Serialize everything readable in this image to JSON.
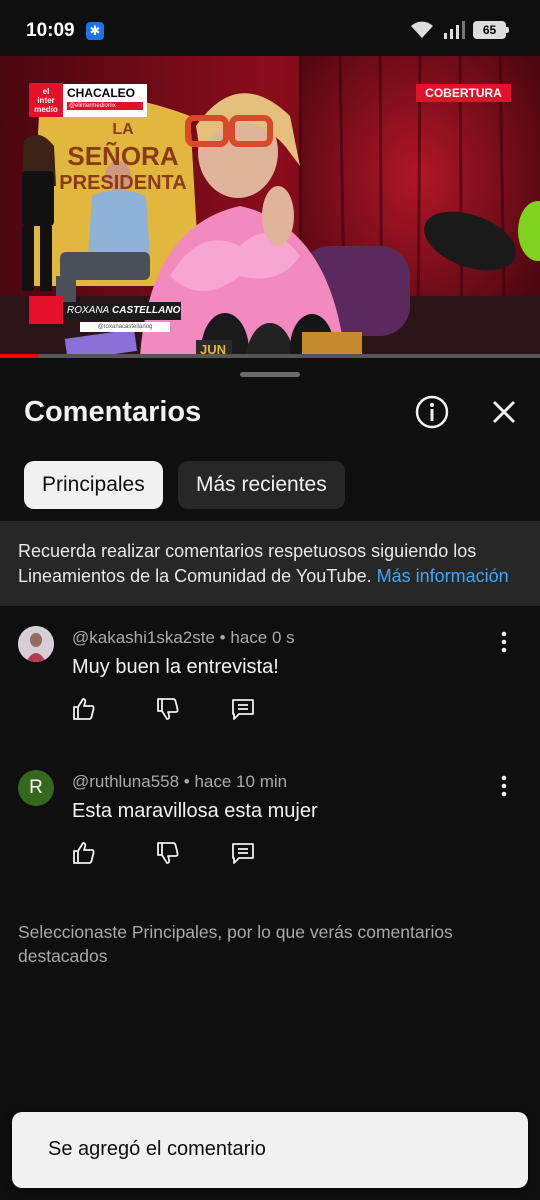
{
  "status": {
    "time": "10:09",
    "battery": "65",
    "app_icon": "snowflake-icon"
  },
  "video": {
    "show_name": "CHACALEO",
    "show_handle": "@elintermediomx",
    "logo_line1": "el",
    "logo_line2": "inter",
    "logo_line3": "medio",
    "badge": "COBERTURA",
    "lower_third_first": "ROXANA",
    "lower_third_last": "CASTELLANO",
    "lower_third_handle": "@roxanacastellanog",
    "backdrop_line1": "LA",
    "backdrop_line2": "SEÑORA",
    "backdrop_line3": "PRESIDENTA",
    "mic_label": "JUN",
    "progress_fraction": 0.07
  },
  "sheet": {
    "title": "Comentarios",
    "tabs": [
      {
        "label": "Principales",
        "selected": true
      },
      {
        "label": "Más recientes",
        "selected": false
      }
    ],
    "guidelines_text": "Recuerda realizar comentarios respetuosos siguiendo los Lineamientos de la Comunidad de YouTube.",
    "guidelines_link": "Más información"
  },
  "comments": [
    {
      "author": "@kakashi1ska2ste",
      "time": "hace 0 s",
      "text": "Muy buen la entrevista!",
      "avatar": "photo"
    },
    {
      "author": "@ruthluna558",
      "time": "hace 10 min",
      "text": "Esta maravillosa esta mujer",
      "avatar_letter": "R"
    }
  ],
  "sort_note": "Seleccionaste Principales, por lo que verás comentarios destacados",
  "toast": {
    "message": "Se agregó el comentario"
  },
  "colors": {
    "background": "#0f0f0f",
    "link": "#3ea6ff",
    "badge": "#e4112b",
    "progress": "#ff0000",
    "chip_active": "#f1f1f1",
    "chip_idle": "#272727"
  }
}
